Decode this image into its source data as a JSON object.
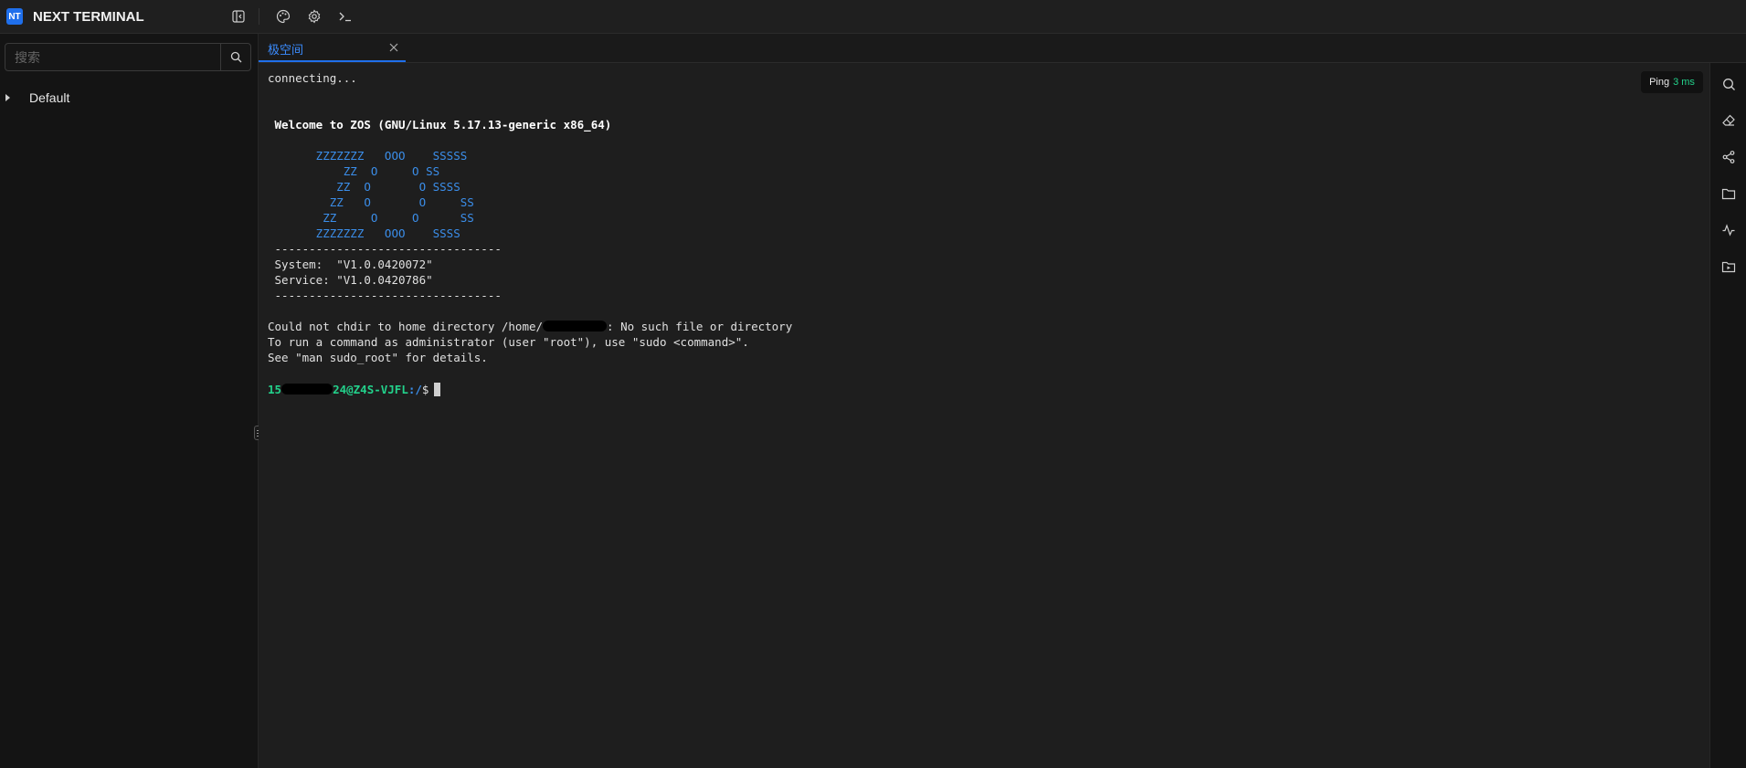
{
  "app": {
    "logo_text": "NT",
    "name": "NEXT TERMINAL"
  },
  "toolbar": {
    "icons": [
      "collapse-sidebar-icon",
      "palette-icon",
      "gear-icon",
      "terminal-prompt-icon"
    ]
  },
  "sidebar": {
    "search": {
      "placeholder": "搜索",
      "value": ""
    },
    "tree": [
      {
        "label": "Default",
        "expanded": false
      }
    ]
  },
  "tabs": [
    {
      "label": "极空间",
      "active": true
    }
  ],
  "terminal": {
    "lines": {
      "connecting": "connecting...",
      "welcome": " Welcome to ZOS (GNU/Linux 5.17.13-generic x86_64)",
      "ascii_art": "       ZZZZZZZ   OOO    SSSSS\n           ZZ  O     O SS\n          ZZ  O       O SSSS\n         ZZ   O       O     SS\n        ZZ     O     O      SS\n       ZZZZZZZ   OOO    SSSS",
      "separator1": " ---------------------------------",
      "system": " System:  \"V1.0.0420072\"",
      "service": " Service: \"V1.0.0420786\"",
      "separator2": " ---------------------------------",
      "chdir_prefix": "Could not chdir to home directory /home/",
      "chdir_suffix": ": No such file or directory",
      "admin_hint": "To run a command as administrator (user \"root\"), use \"sudo <command>\".",
      "man_hint": "See \"man sudo_root\" for details."
    },
    "prompt": {
      "user_prefix": "15",
      "user_suffix": "24@Z4S-VJFL",
      "path": ":/",
      "symbol": "$"
    }
  },
  "ping": {
    "label": "Ping",
    "value": "3 ms"
  },
  "right_toolbar": {
    "icons": [
      "search-icon",
      "eraser-icon",
      "share-icon",
      "folder-icon",
      "activity-icon",
      "folder-video-icon"
    ]
  },
  "colors": {
    "accent": "#1f6feb",
    "ascii": "#3b8eea",
    "prompt_green": "#23d18b",
    "background": "#1e1e1e"
  }
}
